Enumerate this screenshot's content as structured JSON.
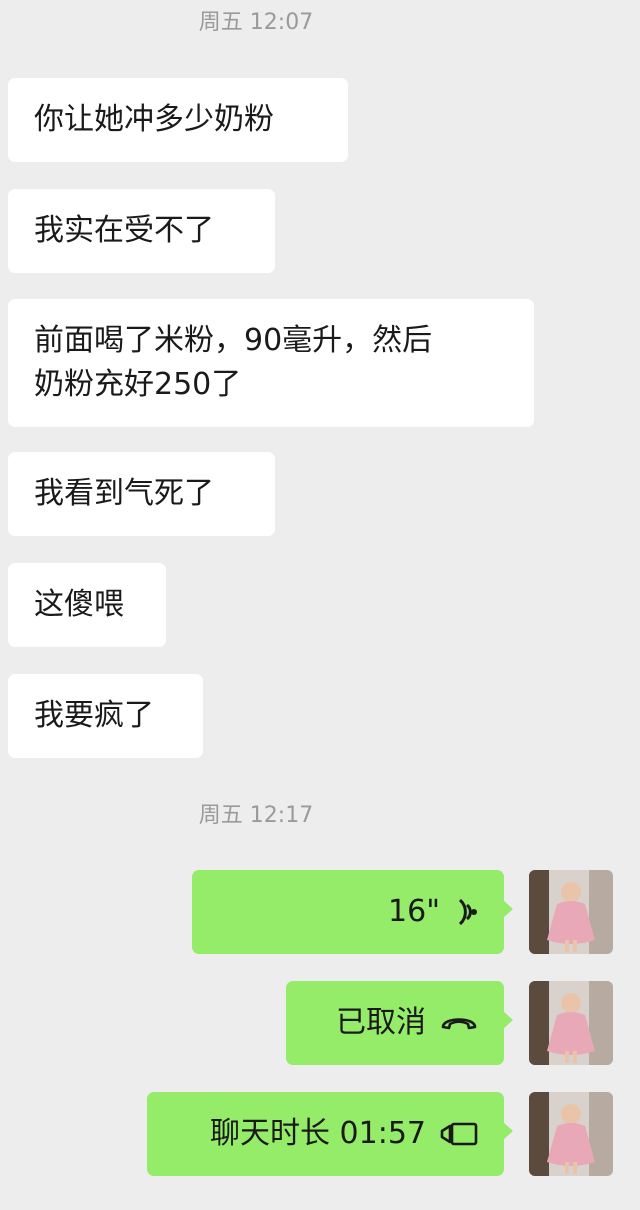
{
  "timestamps": [
    "周五 12:07",
    "周五 12:17"
  ],
  "incoming": [
    "你让她冲多少奶粉",
    "我实在受不了",
    "前面喝了米粉，90毫升，然后\n奶粉充好250了",
    "我看到气死了",
    "这傻喂",
    "我要疯了"
  ],
  "outgoing": [
    {
      "text": "16\"",
      "icon": "voice-wave-icon"
    },
    {
      "text": "已取消",
      "icon": "phone-hangup-icon"
    },
    {
      "text": "聊天时长 01:57",
      "icon": "video-camera-icon"
    }
  ],
  "colors": {
    "background": "#ededed",
    "incoming_bubble": "#ffffff",
    "outgoing_bubble": "#95ec69",
    "timestamp_text": "#9a9a9a"
  }
}
